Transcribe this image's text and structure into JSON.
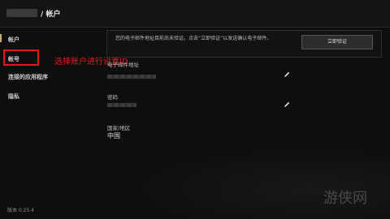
{
  "header": {
    "separator": "/",
    "title": "帐户"
  },
  "sidebar": {
    "items": [
      {
        "label": "帐户"
      },
      {
        "label": "帐号"
      },
      {
        "label": "连接的应用程序"
      },
      {
        "label": "隐私"
      }
    ],
    "version": "版本 0.25.4"
  },
  "annotation": {
    "text": "选择账户进行设置ID",
    "color": "#e01818"
  },
  "notice": {
    "text": "您的电子邮件地址目前尚未验证。点击“立即验证”以发送确认电子邮件。",
    "button_label": "立即验证"
  },
  "fields": {
    "email_label": "电子邮件地址",
    "password_label": "密码",
    "region_label": "国家/地区",
    "region_value": "中国"
  },
  "icons": {
    "edit": "pencil-icon"
  },
  "watermark": "游侠网",
  "accent_color": "#c9aa6a"
}
